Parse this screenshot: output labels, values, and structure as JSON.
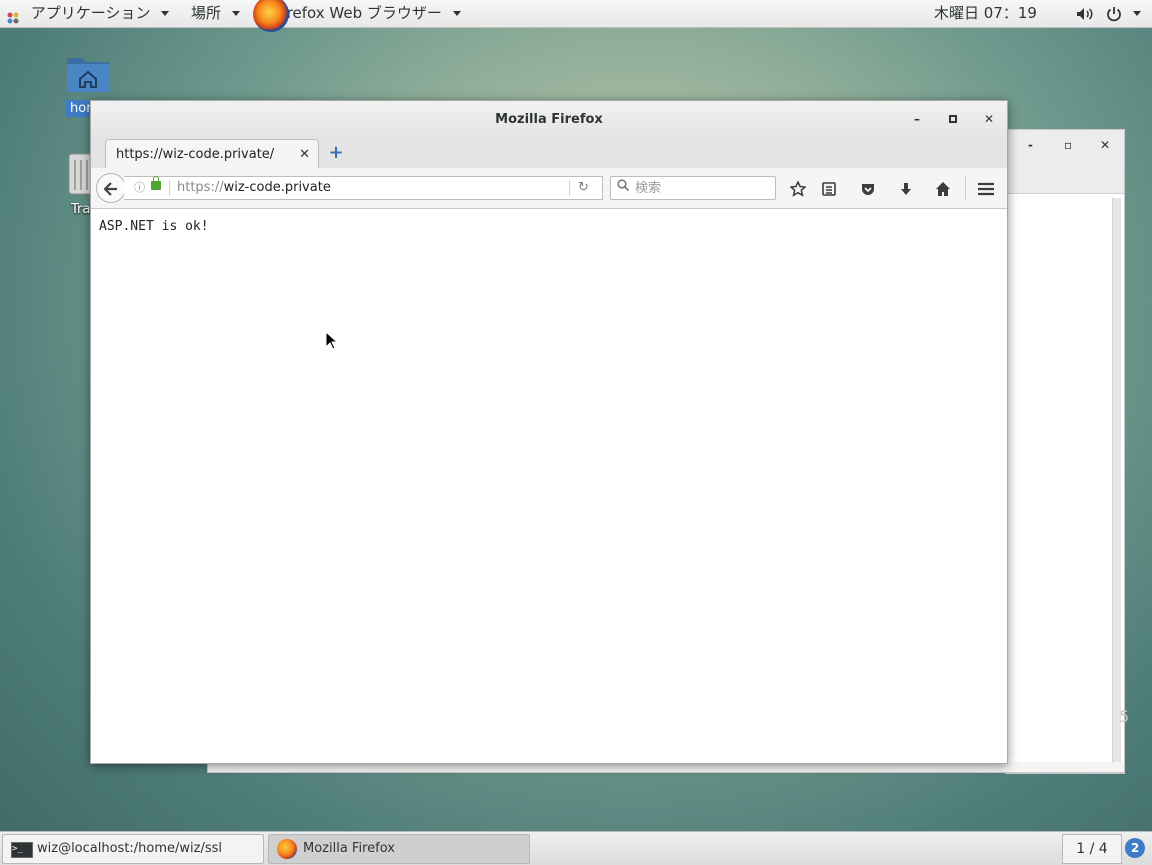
{
  "topbar": {
    "applications_label": "アプリケーション",
    "places_label": "場所",
    "active_app_label": "Firefox Web ブラウザー",
    "clock": "木曜日 07：19"
  },
  "desktop": {
    "home_label": "hor",
    "trash_label": "Tra"
  },
  "background_window": {
    "side_text": "5"
  },
  "firefox": {
    "window_title": "Mozilla Firefox",
    "tab": {
      "label": "https://wiz-code.private/",
      "close": "✕"
    },
    "new_tab": "+",
    "url": {
      "protocol": "https://",
      "host": "wiz-code.private"
    },
    "search_placeholder": "検索",
    "page_text": "ASP.NET is ok!"
  },
  "taskbar": {
    "terminal_label": "wiz@localhost:/home/wiz/ssl",
    "firefox_label": "Mozilla Firefox",
    "workspace": "1 / 4",
    "badge": "2"
  }
}
